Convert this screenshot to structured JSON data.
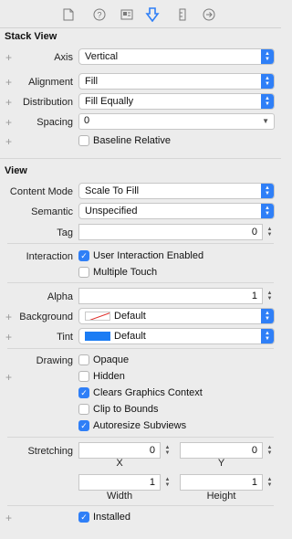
{
  "toolbar": {
    "icons": [
      "file-icon",
      "help-icon",
      "identity-icon",
      "attributes-icon",
      "size-icon",
      "connections-icon"
    ]
  },
  "stack_view": {
    "title": "Stack View",
    "axis_label": "Axis",
    "axis_value": "Vertical",
    "alignment_label": "Alignment",
    "alignment_value": "Fill",
    "distribution_label": "Distribution",
    "distribution_value": "Fill Equally",
    "spacing_label": "Spacing",
    "spacing_value": "0",
    "baseline_label": "Baseline Relative",
    "baseline_checked": false
  },
  "view": {
    "title": "View",
    "content_mode_label": "Content Mode",
    "content_mode_value": "Scale To Fill",
    "semantic_label": "Semantic",
    "semantic_value": "Unspecified",
    "tag_label": "Tag",
    "tag_value": "0",
    "interaction_label": "Interaction",
    "user_interaction_label": "User Interaction Enabled",
    "user_interaction_checked": true,
    "multiple_touch_label": "Multiple Touch",
    "multiple_touch_checked": false,
    "alpha_label": "Alpha",
    "alpha_value": "1",
    "background_label": "Background",
    "background_value": "Default",
    "tint_label": "Tint",
    "tint_value": "Default",
    "tint_color": "#1b7cf4",
    "drawing_label": "Drawing",
    "opaque_label": "Opaque",
    "opaque_checked": false,
    "hidden_label": "Hidden",
    "hidden_checked": false,
    "clears_label": "Clears Graphics Context",
    "clears_checked": true,
    "clip_label": "Clip to Bounds",
    "clip_checked": false,
    "autoresize_label": "Autoresize Subviews",
    "autoresize_checked": true,
    "stretching_label": "Stretching",
    "x_value": "0",
    "x_label": "X",
    "y_value": "0",
    "y_label": "Y",
    "width_value": "1",
    "width_label": "Width",
    "height_value": "1",
    "height_label": "Height",
    "installed_label": "Installed",
    "installed_checked": true
  },
  "accent_color": "#2f7ff7"
}
